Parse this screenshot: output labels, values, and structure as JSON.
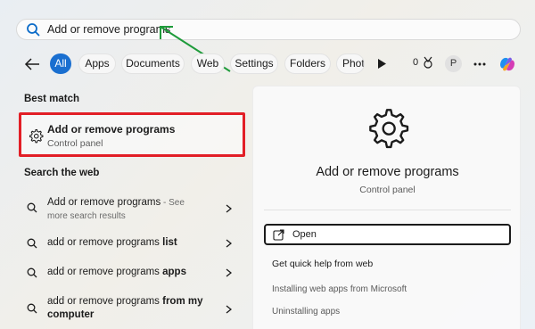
{
  "search": {
    "value": "Add or remove programs",
    "icon": "search-icon"
  },
  "filters": {
    "tabs": [
      {
        "label": "All",
        "active": true
      },
      {
        "label": "Apps"
      },
      {
        "label": "Documents"
      },
      {
        "label": "Web"
      },
      {
        "label": "Settings"
      },
      {
        "label": "Folders"
      },
      {
        "label": "Photo"
      }
    ],
    "points": "0",
    "avatar": "P"
  },
  "best_match": {
    "heading": "Best match",
    "title": "Add or remove programs",
    "subtitle": "Control panel"
  },
  "web": {
    "heading": "Search the web",
    "items": [
      {
        "text": "Add or remove programs",
        "suffix": " - See",
        "sub": "more search results"
      },
      {
        "plain": "add or remove programs ",
        "bold": "list"
      },
      {
        "plain": "add or remove programs ",
        "bold": "apps"
      },
      {
        "plain": "add or remove programs ",
        "bold": "from my computer"
      }
    ]
  },
  "detail": {
    "title": "Add or remove programs",
    "subtitle": "Control panel",
    "open_label": "Open",
    "help_heading": "Get quick help from web",
    "links": [
      "Installing web apps from Microsoft",
      "Uninstalling apps"
    ]
  },
  "colors": {
    "accent": "#1a6fd0",
    "highlight_box": "#e21e26",
    "annotation_arrow": "#1e9b3a"
  }
}
